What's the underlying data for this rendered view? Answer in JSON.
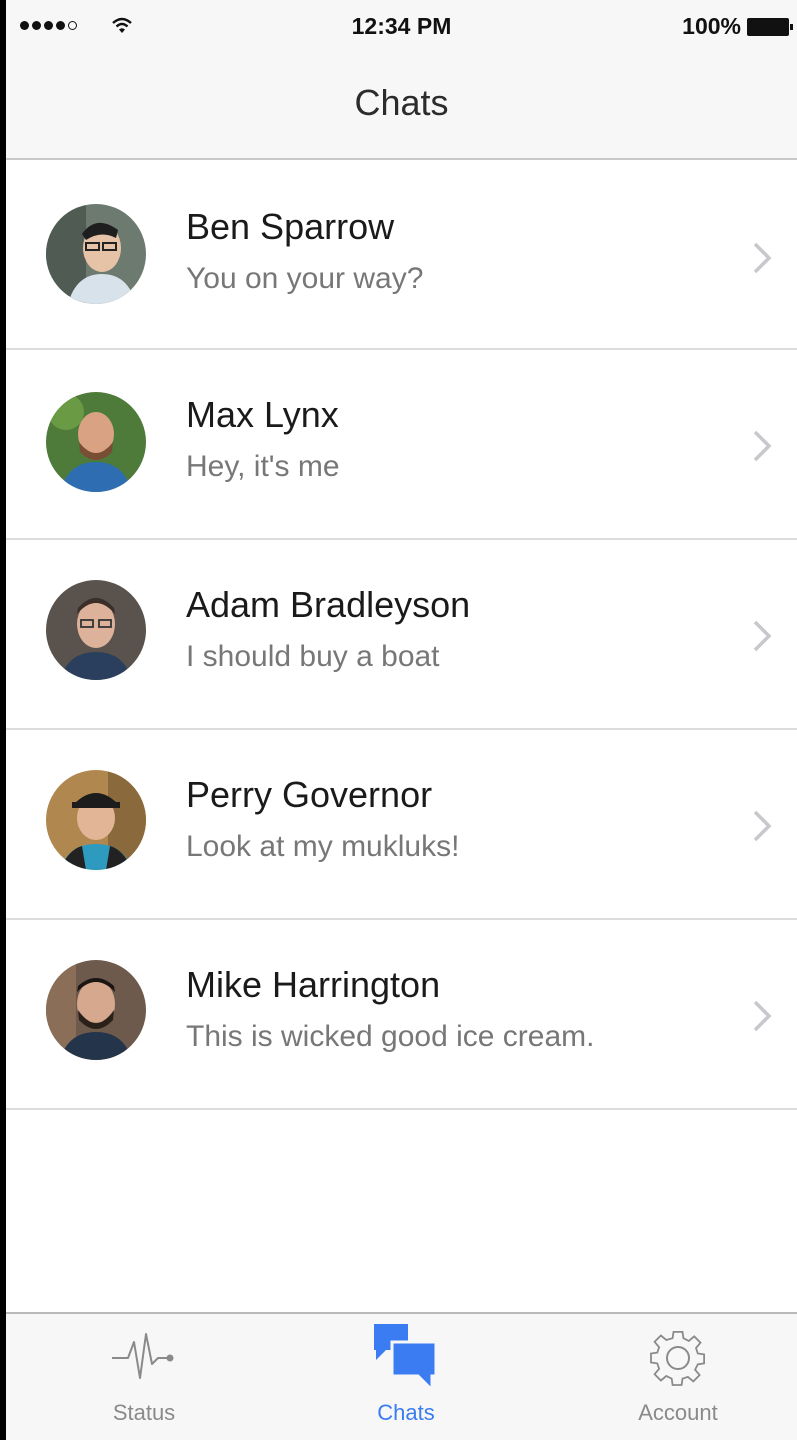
{
  "status_bar": {
    "time": "12:34 PM",
    "battery": "100%",
    "signal_icon": "signal-dots-icon",
    "wifi_icon": "wifi-icon",
    "battery_icon": "battery-icon"
  },
  "nav": {
    "title": "Chats"
  },
  "chats": [
    {
      "name": "Ben Sparrow",
      "message": "You on your way?",
      "avatar_icon": "avatar-photo"
    },
    {
      "name": "Max Lynx",
      "message": "Hey, it's me",
      "avatar_icon": "avatar-photo"
    },
    {
      "name": "Adam Bradleyson",
      "message": "I should buy a boat",
      "avatar_icon": "avatar-photo"
    },
    {
      "name": "Perry Governor",
      "message": "Look at my mukluks!",
      "avatar_icon": "avatar-photo"
    },
    {
      "name": "Mike Harrington",
      "message": "This is wicked good ice cream.",
      "avatar_icon": "avatar-photo"
    }
  ],
  "tabs": [
    {
      "label": "Status",
      "icon": "pulse-icon",
      "active": false
    },
    {
      "label": "Chats",
      "icon": "chat-bubbles-icon",
      "active": true
    },
    {
      "label": "Account",
      "icon": "gear-icon",
      "active": false
    }
  ],
  "colors": {
    "accent": "#3b7cf2",
    "bar_background": "#f7f7f7",
    "separator": "#dcdcdc",
    "text_primary": "#1a1a1a",
    "text_secondary": "#777777"
  }
}
